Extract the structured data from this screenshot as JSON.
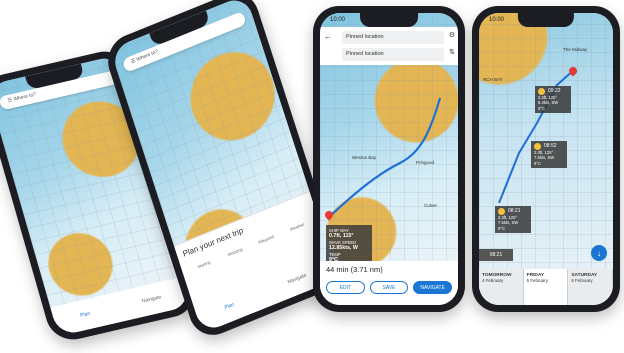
{
  "phone1": {
    "search_placeholder": "Where to?",
    "nav_plan": "Plan",
    "nav_navigate": "Navigate"
  },
  "phone2": {
    "search_placeholder": "Where to?",
    "plan_title": "Plan your next trip",
    "plan_options": [
      "Starting",
      "Stopping",
      "Waypoint",
      "Weather"
    ],
    "nav_plan": "Plan",
    "nav_navigate": "Navigate"
  },
  "phone3": {
    "time": "10:00",
    "from": "Pinned location",
    "to": "Pinned location",
    "info": {
      "l1": "SHIP WAY",
      "l2": "0.7ft, 115°",
      "l3": "WAVE SPEED",
      "l4": "12.85kts, W",
      "l5": "TEMP",
      "l6": "9°C",
      "more": "MORE >"
    },
    "duration": "44 min (3.71 nm)",
    "buttons": {
      "edit": "EDIT",
      "save": "SAVE",
      "navigate": "NAVIGATE"
    },
    "map_labels": {
      "weston": "Weston Bay",
      "pincode": "Pringood",
      "cove": "Culver"
    }
  },
  "phone4": {
    "time": "10:00",
    "place": "RCH BAY",
    "midway": "The Midway",
    "wx": [
      {
        "time": "09:22",
        "l1": "2.3ft, 125°",
        "l2": "8.4kts, SW",
        "l3": "9°C"
      },
      {
        "time": "08:52",
        "l1": "2.3ft, 125°",
        "l2": "7.5kts, SW",
        "l3": "9°C"
      },
      {
        "time": "08:21",
        "l1": "2.3ft, 125°",
        "l2": "7.5kts, SW",
        "l3": "9°C"
      }
    ],
    "current_time": "08:21",
    "days": [
      {
        "name": "TOMORROW",
        "date": "4 February"
      },
      {
        "name": "FRIDAY",
        "date": "5 February"
      },
      {
        "name": "SATURDAY",
        "date": "6 February"
      }
    ]
  }
}
